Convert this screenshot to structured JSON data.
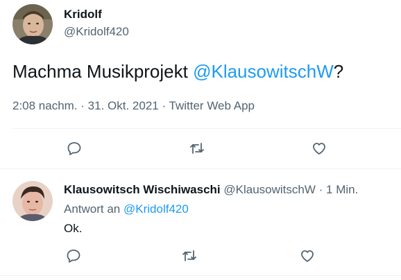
{
  "main_tweet": {
    "author_name": "Kridolf",
    "author_handle": "@Kridolf420",
    "text_before_mention": "Machma Musikprojekt ",
    "mention": "@KlausowitschW",
    "text_after_mention": "?",
    "meta": "2:08 nachm. · 31. Okt. 2021 · Twitter Web App",
    "actions": [
      "reply-icon",
      "retweet-icon",
      "like-icon"
    ]
  },
  "reply_tweet": {
    "author_name": "Klausowitsch Wischiwaschi",
    "author_handle": "@KlausowitschW",
    "separator": "·",
    "time": "1 Min.",
    "reply_prefix": "Antwort an ",
    "reply_to": "@Kridolf420",
    "text": "Ok.",
    "actions": [
      "reply-icon",
      "retweet-icon",
      "like-icon"
    ]
  },
  "colors": {
    "link": "#1d9bf0",
    "muted": "#536471",
    "divider": "#eff3f4"
  }
}
